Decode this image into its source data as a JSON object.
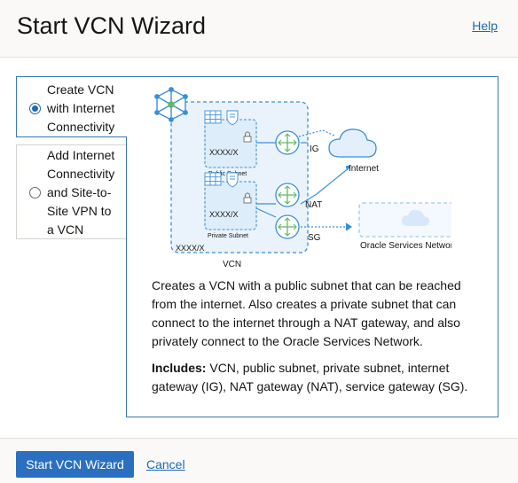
{
  "header": {
    "title": "Start VCN Wizard",
    "help_label": "Help"
  },
  "options": [
    {
      "label": "Create VCN\nwith Internet\nConnectivity",
      "selected": true
    },
    {
      "label": "Add Internet\nConnectivity\nand Site-to-\nSite VPN to\na VCN",
      "selected": false
    }
  ],
  "diagram": {
    "public_subnet_cidr": "XXXX/X",
    "public_subnet_label": "Public Subnet",
    "private_subnet_cidr": "XXXX/X",
    "private_subnet_label": "Private Subnet",
    "vcn_cidr": "XXXX/X",
    "vcn_label": "VCN",
    "ig_label": "IG",
    "nat_label": "NAT",
    "sg_label": "SG",
    "internet_label": "Internet",
    "osn_label": "Oracle Services Network",
    "colors": {
      "accent": "#3a8fd8",
      "subnet_fill": "#ddeefa",
      "vcn_fill": "#eaf3fb",
      "router_fill": "#ffffff",
      "cloud_fill": "#e3f0fb"
    }
  },
  "description": "Creates a VCN with a public subnet that can be reached from the internet. Also creates a private subnet that can connect to the internet through a NAT gateway, and also privately connect to the Oracle Services Network.",
  "includes": {
    "label": "Includes:",
    "text": " VCN, public subnet, private subnet, internet gateway (IG), NAT gateway (NAT), service gateway (SG)."
  },
  "footer": {
    "start_button": "Start VCN Wizard",
    "cancel_label": "Cancel"
  },
  "colors": {
    "primary": "#2a6fc0",
    "link": "#1a6ab8",
    "panel_border": "#3a77b5"
  }
}
